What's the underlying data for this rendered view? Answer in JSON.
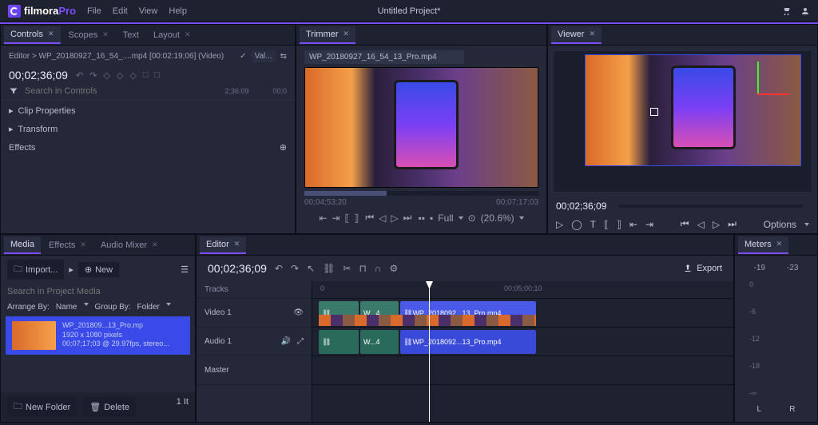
{
  "app": {
    "name_a": "filmora",
    "name_b": "Pro",
    "title": "Untitled Project*"
  },
  "menu": [
    "File",
    "Edit",
    "View",
    "Help"
  ],
  "controls": {
    "tabs": [
      {
        "label": "Controls",
        "active": true
      },
      {
        "label": "Scopes"
      },
      {
        "label": "Text"
      },
      {
        "label": "Layout"
      }
    ],
    "path": "Editor > WP_20180927_16_54_....mp4 [00:02:19;06] (Video)",
    "value_label": "Val...",
    "timecode": "00;02;36;09",
    "search_placeholder": "Search in Controls",
    "ruler": [
      "2;36;09",
      "00;0"
    ],
    "items": [
      "Clip Properties",
      "Transform",
      "Effects"
    ]
  },
  "trimmer": {
    "tab": "Trimmer",
    "clip_name": "WP_20180927_16_54_13_Pro.mp4",
    "in_tc": "00;04;53;20",
    "out_tc": "00;07;17;03",
    "scale_label": "Full",
    "zoom": "(20.6%)"
  },
  "viewer": {
    "tab": "Viewer",
    "timecode": "00;02;36;09",
    "options": "Options"
  },
  "media": {
    "tabs": [
      {
        "label": "Media",
        "active": true
      },
      {
        "label": "Effects"
      },
      {
        "label": "Audio Mixer"
      }
    ],
    "import": "Import...",
    "new": "New",
    "search_placeholder": "Search in Project Media",
    "arrange_label": "Arrange By:",
    "arrange_value": "Name",
    "group_label": "Group By:",
    "group_value": "Folder",
    "item_name": "WP_201809...13_Pro.mp",
    "item_res": "1920 x 1080 pixels",
    "item_meta": "00;07;17;03 @ 29.97fps, stereo...",
    "new_folder": "New Folder",
    "delete": "Delete",
    "count": "1 It"
  },
  "editor": {
    "tab": "Editor",
    "timecode": "00;02;36;09",
    "export": "Export",
    "tracks_label": "Tracks",
    "ruler": [
      "0",
      "00;05;00;10"
    ],
    "video_track": "Video 1",
    "audio_track": "Audio 1",
    "master": "Master",
    "clip_small": "W...4",
    "clip_main": "WP_2018092...13_Pro.mp4"
  },
  "meters": {
    "tab": "Meters",
    "left_val": "-19",
    "right_val": "-23",
    "scale": [
      "0",
      "-6",
      "-12",
      "-18",
      "-∞"
    ],
    "l": "L",
    "r": "R"
  }
}
